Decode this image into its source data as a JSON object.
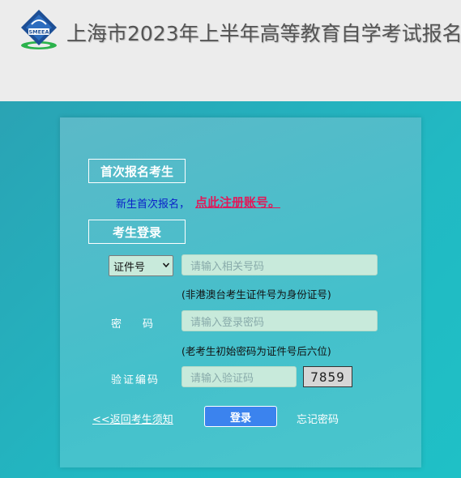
{
  "header": {
    "logo_text": "SMEEA",
    "title": "上海市2023年上半年高等教育自学考试报名"
  },
  "first_registration": {
    "section_label": "首次报名考生",
    "new_text": "新生首次报名，",
    "register_link": "点此注册账号。"
  },
  "login": {
    "section_label": "考生登录",
    "id_type_selected": "证件号",
    "id_placeholder": "请输入相关号码",
    "id_hint": "(非港澳台考生证件号为身份证号)",
    "password_label": "密　　码",
    "password_placeholder": "请输入登录密码",
    "password_hint": "(老考生初始密码为证件号后六位)",
    "captcha_label": "验证编码",
    "captcha_placeholder": "请输入验证码",
    "captcha_text": "7859",
    "back_link": "<<返回考生须知",
    "login_button": "登录",
    "forgot_link": "忘记密码"
  },
  "colors": {
    "accent_blue": "#3b83ee",
    "register_link": "#e01a5a",
    "input_bg": "#c8eadb"
  }
}
